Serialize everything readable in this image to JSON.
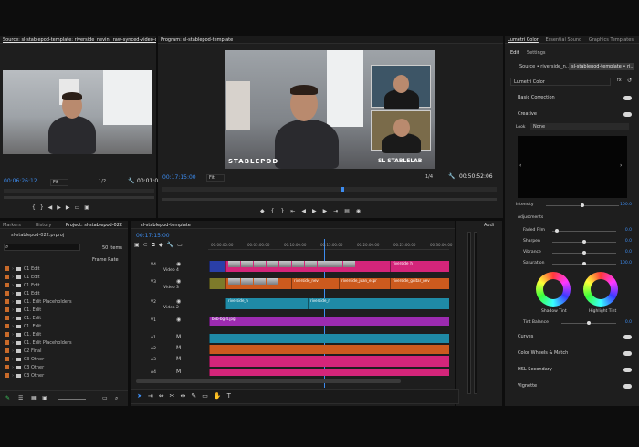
{
  "source": {
    "tab": "Source: sl-stablepod-template: riverside_nevin_ raw-synced-video-cfr_stablep",
    "timecode_in": "00:06:26:12",
    "fit": "Fit",
    "ratio": "1/2",
    "timecode_out": "00:01:0"
  },
  "program": {
    "tab": "Program: sl-stablepod-template",
    "timecode_in": "00:17:15:00",
    "fit": "Fit",
    "ratio": "1/4",
    "timecode_out": "00:50:52:06",
    "brand_left": "STABLEPOD",
    "brand_right": "SL STABLELAB"
  },
  "project": {
    "tabs": [
      "Markers",
      "History",
      "Project: sl-stablepod-022"
    ],
    "file": "sl-stablepod-022.prproj",
    "items_count": "50 Items",
    "search_placeholder": "",
    "col_frame_rate": "Frame Rate",
    "rows": [
      "01 Edit",
      "01 Edit",
      "01 Edit",
      "01 Edit",
      "01. Edit Placeholders",
      "01. Edit",
      "01. Edit",
      "01. Edit",
      "01. Edit",
      "01. Edit Placeholders",
      "02 Final",
      "03 Other",
      "03 Other",
      "03 Other"
    ]
  },
  "timeline": {
    "tab": "sl-stablepod-template",
    "timecode": "00:17:15:00",
    "ruler": [
      "00:00:00:00",
      "00:05:00:00",
      "00:10:00:00",
      "00:15:00:00",
      "00:20:00:00",
      "00:25:00:00",
      "00:30:00:00"
    ],
    "tracks": [
      {
        "id": "V4",
        "name": "Video 4"
      },
      {
        "id": "V3",
        "name": "Video 3"
      },
      {
        "id": "V2",
        "name": "Video 2"
      },
      {
        "id": "V1",
        "name": "V1"
      },
      {
        "id": "A1",
        "name": "A1"
      },
      {
        "id": "A2",
        "name": "A2"
      },
      {
        "id": "A3",
        "name": "A3"
      },
      {
        "id": "A4",
        "name": "A4"
      }
    ],
    "clip_labels": {
      "v4a": "riverside_h",
      "v4b": "riverside_h",
      "v3a": "riverside_nev",
      "v3b": "riverside_...",
      "v3c": "riverside_juan_espr",
      "v3d": "riverside_guitar_nev",
      "v2a": "riverside_n",
      "v2b": "riverside_n",
      "v1": "bob-bg-4.jpg"
    },
    "audio_label": "Audi"
  },
  "lumetri": {
    "tabs": [
      "Lumetri Color",
      "Essential Sound",
      "Graphics Templates"
    ],
    "subtabs": [
      "Edit",
      "Settings"
    ],
    "source_dd": "Source • riverside_n...",
    "seq_dd": "sl-stablepod-template • ri...",
    "effect": "Lumetri Color",
    "basic": "Basic Correction",
    "creative": "Creative",
    "look_label": "Look",
    "look_value": "None",
    "intensity_label": "Intensity",
    "intensity": "100.0",
    "adjustments": "Adjustments",
    "sliders": [
      {
        "label": "Faded Film",
        "value": "0.0"
      },
      {
        "label": "Sharpen",
        "value": "0.0"
      },
      {
        "label": "Vibrance",
        "value": "0.0"
      },
      {
        "label": "Saturation",
        "value": "100.0"
      }
    ],
    "shadow_tint": "Shadow Tint",
    "highlight_tint": "Highlight Tint",
    "tint_balance": "Tint Balance",
    "tint_balance_val": "0.0",
    "sections": [
      "Curves",
      "Color Wheels & Match",
      "HSL Secondary",
      "Vignette"
    ]
  }
}
